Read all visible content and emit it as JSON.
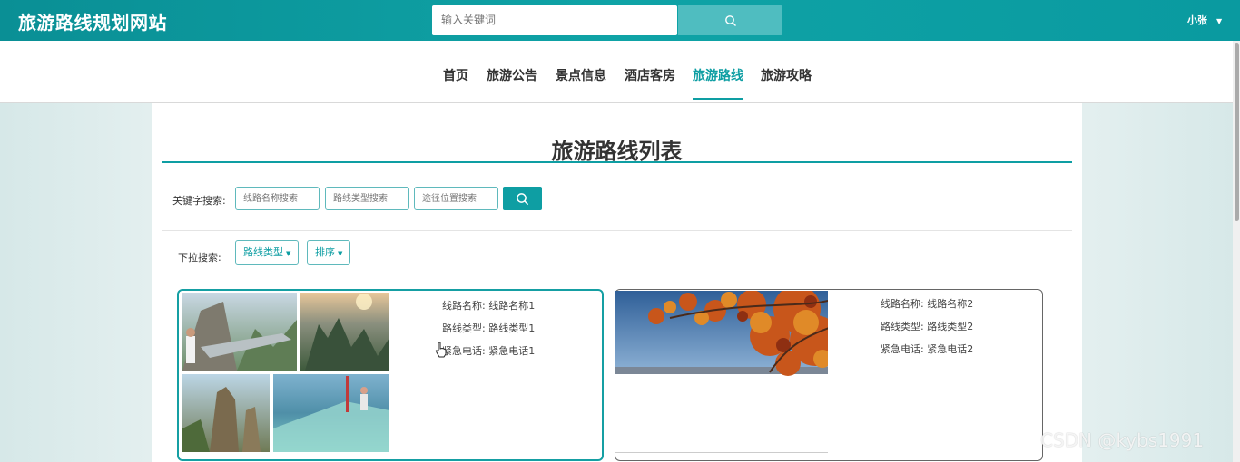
{
  "header": {
    "site_title": "旅游路线规划网站",
    "search_placeholder": "输入关键词",
    "user_name": "小张",
    "caret": "▼"
  },
  "nav": {
    "items": [
      {
        "label": "首页"
      },
      {
        "label": "旅游公告"
      },
      {
        "label": "景点信息"
      },
      {
        "label": "酒店客房"
      },
      {
        "label": "旅游路线",
        "active": true
      },
      {
        "label": "旅游攻略"
      }
    ]
  },
  "page": {
    "title": "旅游路线列表",
    "keyword_label": "关键字搜索:",
    "keyword_inputs": [
      {
        "placeholder": "线路名称搜索"
      },
      {
        "placeholder": "路线类型搜索"
      },
      {
        "placeholder": "途径位置搜索"
      }
    ],
    "dropdown_label": "下拉搜索:",
    "dropdowns": [
      {
        "label": "路线类型"
      },
      {
        "label": "排序"
      }
    ]
  },
  "cards": [
    {
      "fields": [
        {
          "label": "线路名称:",
          "value": "线路名称1"
        },
        {
          "label": "路线类型:",
          "value": "路线类型1"
        },
        {
          "label": "紧急电话:",
          "value": "紧急电话1"
        }
      ]
    },
    {
      "fields": [
        {
          "label": "线路名称:",
          "value": "线路名称2"
        },
        {
          "label": "路线类型:",
          "value": "路线类型2"
        },
        {
          "label": "紧急电话:",
          "value": "紧急电话2"
        }
      ]
    }
  ],
  "watermark": "CSDN @kybs1991",
  "colors": {
    "accent": "#0e9ea3",
    "header": "#0fa3a6"
  }
}
